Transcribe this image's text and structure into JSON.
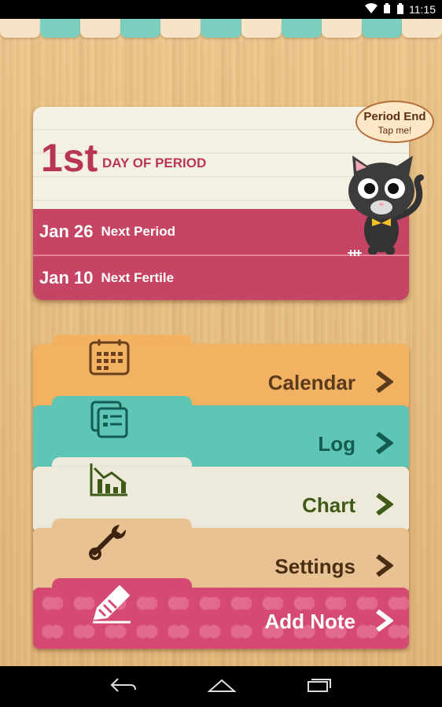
{
  "status_bar": {
    "time": "11:15",
    "icons": [
      "wifi-icon",
      "signal-icon",
      "battery-icon"
    ]
  },
  "period_card": {
    "day_number": "1st",
    "day_label": "DAY OF PERIOD",
    "rows": [
      {
        "date": "Jan 26",
        "label": "Next Period"
      },
      {
        "date": "Jan 10",
        "label": "Next Fertile"
      }
    ]
  },
  "bubble": {
    "title": "Period End",
    "subtitle": "Tap me!"
  },
  "menu": [
    {
      "label": "Calendar",
      "icon": "calendar-icon"
    },
    {
      "label": "Log",
      "icon": "log-icon"
    },
    {
      "label": "Chart",
      "icon": "chart-icon"
    },
    {
      "label": "Settings",
      "icon": "wrench-icon"
    },
    {
      "label": "Add Note",
      "icon": "pencil-icon"
    }
  ],
  "nav": {
    "icons": [
      "back-icon",
      "home-icon",
      "recents-icon"
    ]
  },
  "colors": {
    "accent": "#c64564",
    "calendar": "#f3b261",
    "log": "#5fc6b6",
    "chart": "#eeeadb",
    "settings": "#e9c293",
    "note": "#d44a72"
  }
}
